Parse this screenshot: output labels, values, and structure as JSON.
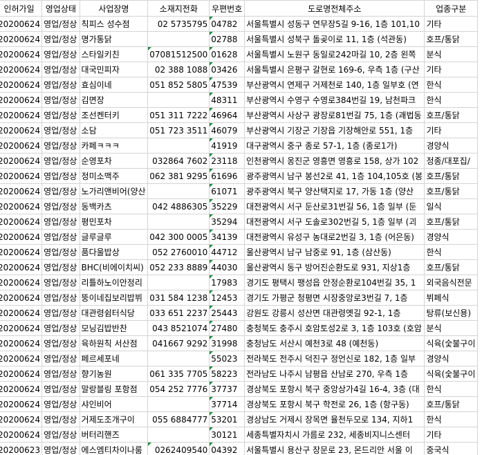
{
  "columns": [
    "인허가일",
    "영업상태",
    "사업장명",
    "소재지전화",
    "우편번호",
    "도로명전체주소",
    "업종구분"
  ],
  "rows": [
    {
      "date": "20200624",
      "status": "영업/정상",
      "name": "칙피스 성수점",
      "phone": "02 5735795",
      "zip": "04782",
      "addr": "서울특별시 성동구 연무장5길 9-16, 1층 101,10",
      "type": "기타"
    },
    {
      "date": "20200624",
      "status": "영업/정상",
      "name": "명가통닭",
      "phone": "",
      "zip": "02788",
      "addr": "서울특별시 성북구 돌곶이로 11, 1층 (석관동)",
      "type": "호프/통닭"
    },
    {
      "date": "20200624",
      "status": "영업/정상",
      "name": "스타일키친",
      "phone": "07081512500",
      "zip": "01628",
      "addr": "서울특별시 노원구 동일로242마길 10, 2층 왼쪽",
      "type": "분식"
    },
    {
      "date": "20200624",
      "status": "영업/정상",
      "name": "대국민피자",
      "phone": "02  388 1088",
      "zip": "03426",
      "addr": "서울특별시 은평구 갈현로 169-6, 우측 1층 (구산",
      "type": "기타"
    },
    {
      "date": "20200624",
      "status": "영업/정상",
      "name": "효심이네",
      "phone": "051 852 5805",
      "zip": "47539",
      "addr": "부산광역시 연제구 거제천로 140, 1층 일부호 (연",
      "type": "한식"
    },
    {
      "date": "20200624",
      "status": "영업/정상",
      "name": "김면장",
      "phone": "",
      "zip": "48311",
      "addr": "부산광역시 수영구 수영로384번길 19, 남천파크",
      "type": "한식"
    },
    {
      "date": "20200624",
      "status": "영업/정상",
      "name": "조선켄터키",
      "phone": "051 311 7222",
      "zip": "46964",
      "addr": "부산광역시 사상구 광장로81번길 75, 1층 (괘법동",
      "type": "호프/통닭"
    },
    {
      "date": "20200624",
      "status": "영업/정상",
      "name": "소담",
      "phone": "051 723 3511",
      "zip": "46079",
      "addr": "부산광역시 기장군 기장읍 기장해안로 551, 1층",
      "type": "기타"
    },
    {
      "date": "20200624",
      "status": "영업/정상",
      "name": "카페ㅋㅋㅋ",
      "phone": "",
      "zip": "41919",
      "addr": "대구광역시 중구 종로 57-1, 1층 (종로1가)",
      "type": "경양식"
    },
    {
      "date": "20200624",
      "status": "영업/정상",
      "name": "순영포차",
      "phone": "032864 7602",
      "zip": "23118",
      "addr": "인천광역시 옹진군 영흥면 영흥로 158, 상가 102",
      "type": "정종/대포집/"
    },
    {
      "date": "20200624",
      "status": "영업/정상",
      "name": "정미소맥주",
      "phone": "062 381 9295",
      "zip": "61696",
      "addr": "광주광역시 남구 봉선2로 41, 1층 104,105호 (봉",
      "type": "호프/통닭"
    },
    {
      "date": "20200624",
      "status": "영업/정상",
      "name": "노가리앤비어(양산",
      "phone": "",
      "zip": "61071",
      "addr": "광주광역시 북구 양산택지로 17, 가동 1층 (양산",
      "type": "호프/통닭"
    },
    {
      "date": "20200624",
      "status": "영업/정상",
      "name": "동백카츠",
      "phone": "042 4886305",
      "zip": "35229",
      "addr": "대전광역시 서구 둔산로31번길 56, 1층 일부 (둔",
      "type": "일식"
    },
    {
      "date": "20200624",
      "status": "영업/정상",
      "name": "평민포차",
      "phone": "",
      "zip": "35294",
      "addr": "대전광역시 서구 도솔로302번길 5, 1층 일부 (괴",
      "type": "호프/통닭"
    },
    {
      "date": "20200624",
      "status": "영업/정상",
      "name": "글루글루",
      "phone": "042 300 0005",
      "zip": "34139",
      "addr": "대전광역시 유성구 농대로2번길 3, 1층 (어은동)",
      "type": "경양식"
    },
    {
      "date": "20200624",
      "status": "영업/정상",
      "name": "품다울밥상",
      "phone": "052 2760010",
      "zip": "44712",
      "addr": "울산광역시 남구 남중로 91, 1층 (삼산동)",
      "type": "한식"
    },
    {
      "date": "20200624",
      "status": "영업/정상",
      "name": "BHC(비에이치씨)",
      "phone": "052 233 8889",
      "zip": "44030",
      "addr": "울산광역시 동구 방어진순환도로 931, 지상1층",
      "type": "호프/통닭"
    },
    {
      "date": "20200624",
      "status": "영업/정상",
      "name": "리틀하노이안정리",
      "phone": "",
      "zip": "17983",
      "addr": "경기도 평택시 팽성읍 안정순환로104번길 35, 1",
      "type": "외국음식전문"
    },
    {
      "date": "20200624",
      "status": "영업/정상",
      "name": "뚱이네집보리밥뷔",
      "phone": "031 584 1238",
      "zip": "12453",
      "addr": "경기도 가평군 청평면 시장중앙로3번길 7, 1층",
      "type": "뷔페식"
    },
    {
      "date": "20200624",
      "status": "영업/정상",
      "name": "대관령쉼터식당",
      "phone": "033 651 2237",
      "zip": "25443",
      "addr": "강원도 강릉시 성산면 대관령옛길 92-1, 1층",
      "type": "탕류(보신용)"
    },
    {
      "date": "20200624",
      "status": "영업/정상",
      "name": "모닝김밥반찬",
      "phone": "043 8521074",
      "zip": "27480",
      "addr": "충청북도 충주시 호암토성2로 3, 1층 103호 (호암",
      "type": "분식"
    },
    {
      "date": "20200624",
      "status": "영업/정상",
      "name": "육하원칙 서산점",
      "phone": "041667 9292",
      "zip": "31998",
      "addr": "충청남도 서산시 예천3로 48 (예천동)",
      "type": "식육(숯불구이"
    },
    {
      "date": "20200624",
      "status": "영업/정상",
      "name": "페르세포네",
      "phone": "",
      "zip": "55023",
      "addr": "전라북도 전주시 덕진구 정언신로 182, 1층 일부",
      "type": "경양식"
    },
    {
      "date": "20200624",
      "status": "영업/정상",
      "name": "향기농원",
      "phone": "061 335 7705",
      "zip": "58223",
      "addr": "전라남도 나주시 남평읍 산남로 270, 우측 1층",
      "type": "식육(숯불구이"
    },
    {
      "date": "20200624",
      "status": "영업/정상",
      "name": "말랑블링 포항점",
      "phone": "054 252 7776",
      "zip": "37737",
      "addr": "경상북도 포항시 북구 중앙상가4길 16-4, 3층 (대",
      "type": "한식"
    },
    {
      "date": "20200624",
      "status": "영업/정상",
      "name": "샤인비어",
      "phone": "",
      "zip": "37714",
      "addr": "경상북도 포항시 북구 학전로 26, 1층 (항구동)",
      "type": "호프/통닭"
    },
    {
      "date": "20200624",
      "status": "영업/정상",
      "name": "거제도조개구이",
      "phone": "055 6884777",
      "zip": "53201",
      "addr": "경상남도 거제시 장목면 율천두모로 134, 지하1",
      "type": "한식"
    },
    {
      "date": "20200624",
      "status": "영업/정상",
      "name": "버터리핸즈",
      "phone": "",
      "zip": "30121",
      "addr": "세종특별자치시 가름로 232, 세종비지니스센터",
      "type": "기타"
    },
    {
      "date": "20200623",
      "status": "영업/정상",
      "name": "에스엠티차이나룸",
      "phone": "0262409540",
      "zip": "04392",
      "addr": "서울특별시 용산구 장문로 23, 몬드리안 서울 이",
      "type": "중국식"
    }
  ]
}
